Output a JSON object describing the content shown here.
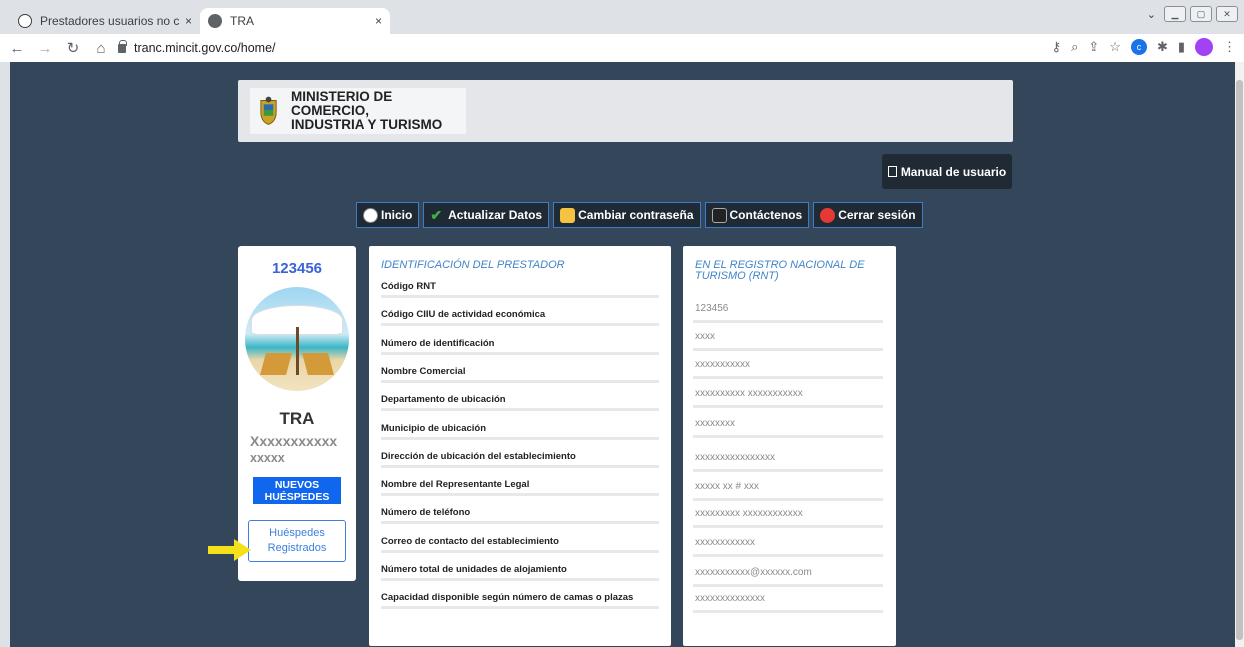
{
  "browser": {
    "tabs": [
      {
        "title": "Prestadores usuarios no conectad",
        "active": false
      },
      {
        "title": "TRA",
        "active": true
      }
    ],
    "url": "tranc.mincit.gov.co/home/",
    "close_glyph": "×"
  },
  "header": {
    "ministry_line1": "MINISTERIO DE COMERCIO,",
    "ministry_line2": "INDUSTRIA Y TURISMO"
  },
  "manual_button": "Manual de usuario",
  "nav": {
    "inicio": "Inicio",
    "actualizar": "Actualizar Datos",
    "cambiar": "Cambiar contraseña",
    "contacto": "Contáctenos",
    "cerrar": "Cerrar sesión"
  },
  "profile": {
    "id": "123456",
    "name": "TRA",
    "sub_line1": "Xxxxxxxxxxx",
    "sub_line2": "xxxxx",
    "nuevos_line1": "NUEVOS",
    "nuevos_line2": "HUÉSPEDES",
    "registrados_line1": "Huéspedes",
    "registrados_line2": "Registrados"
  },
  "identificacion": {
    "heading": "IDENTIFICACIÓN DEL PRESTADOR",
    "fields": [
      "Código RNT",
      "Código CIIU de actividad económica",
      "Número de identificación",
      "Nombre Comercial",
      "Departamento de ubicación",
      "Municipio de ubicación",
      "Dirección de ubicación del establecimiento",
      "Nombre del Representante Legal",
      "Número de teléfono",
      "Correo de contacto del establecimiento",
      "Número total de unidades de alojamiento",
      "Capacidad disponible según número de camas o plazas"
    ]
  },
  "registro": {
    "heading_line1": "EN EL REGISTRO NACIONAL DE",
    "heading_line2": "TURISMO (RNT)",
    "values": [
      "123456",
      "xxxx",
      "xxxxxxxxxxx",
      "xxxxxxxxxx xxxxxxxxxxx",
      "xxxxxxxx",
      "xxxxxxxxxxxxxxxx",
      "xxxxx  xx # xxx",
      "xxxxxxxxx xxxxxxxxxxxx",
      "xxxxxxxxxxxx",
      "xxxxxxxxxxx@xxxxxx.com",
      "xxxxxxxxxxxxxx"
    ]
  },
  "colors": {
    "page_bg": "#34475a",
    "accent_blue": "#1166ee",
    "nav_bg": "#1f2a35",
    "heading_blue": "#3f84c8"
  },
  "icons": [
    "globe-icon",
    "lock-icon",
    "pdf-icon",
    "home-icon",
    "checkmark-icon",
    "key-icon",
    "contact-icon",
    "power-icon",
    "arrow-icon"
  ]
}
